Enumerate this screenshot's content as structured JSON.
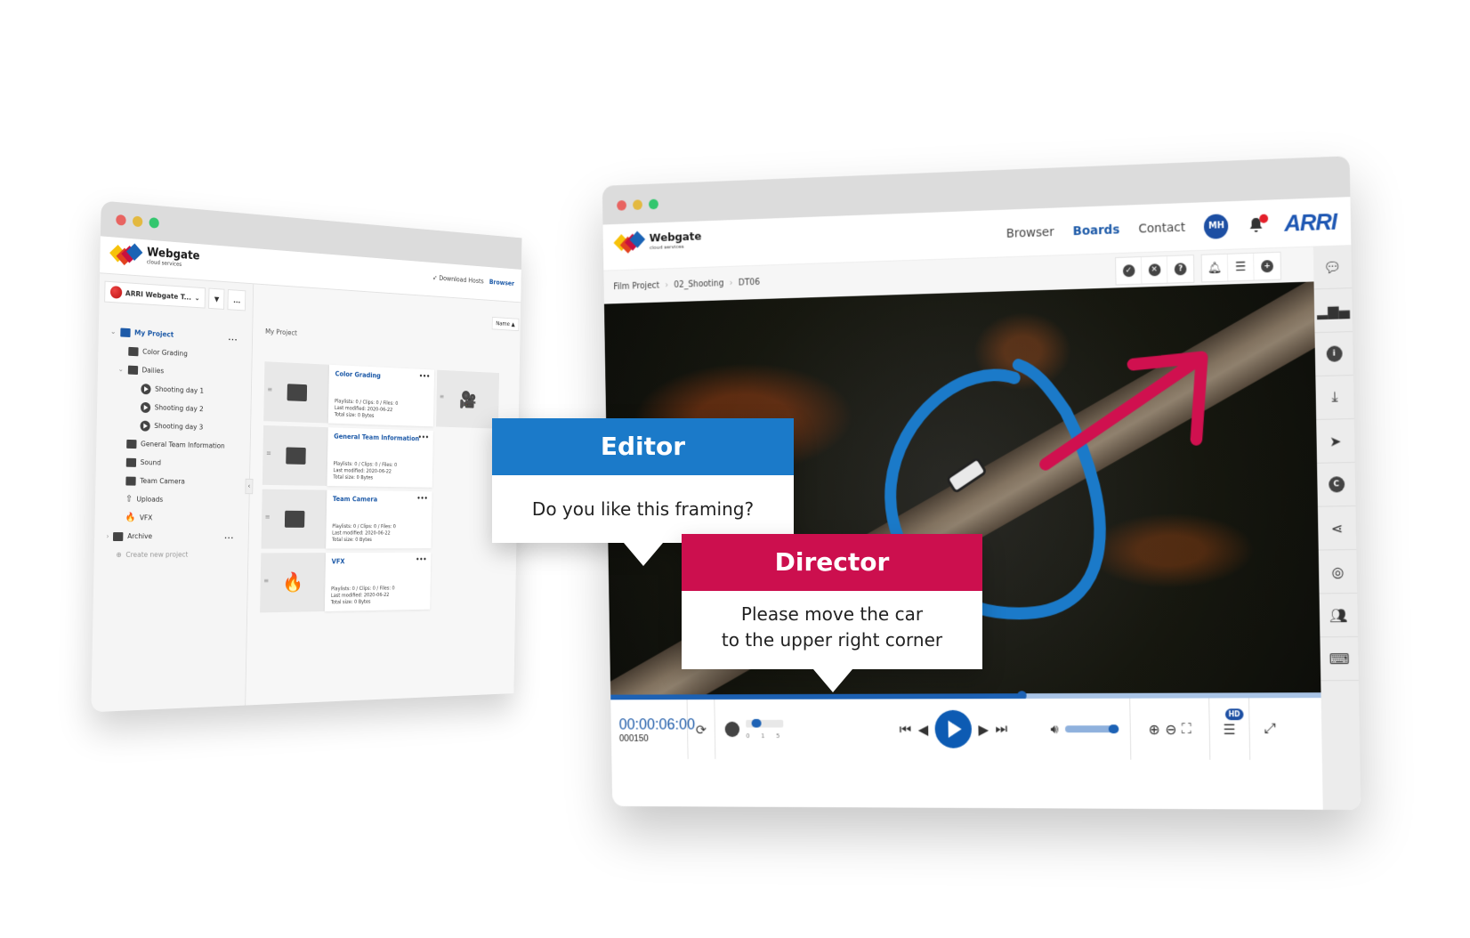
{
  "back_window": {
    "logo": {
      "name": "Webgate",
      "sub": "cloud services"
    },
    "top_links": {
      "download_hosts": "Download Hosts",
      "browser": "Browser"
    },
    "workspace": {
      "name": "ARRI Webgate T...",
      "filter_label": "Filter",
      "more_label": "..."
    },
    "tree": [
      {
        "label": "My Project",
        "level": 0,
        "icon": "briefcase-icon",
        "expanded": true,
        "active": true,
        "more": "..."
      },
      {
        "label": "Color Grading",
        "level": 1,
        "icon": "image-folder-icon"
      },
      {
        "label": "Dailies",
        "level": 1,
        "icon": "movie-camera-icon",
        "expanded": true
      },
      {
        "label": "Shooting day 1",
        "level": 2,
        "icon": "play-circle-icon"
      },
      {
        "label": "Shooting day 2",
        "level": 2,
        "icon": "play-circle-icon"
      },
      {
        "label": "Shooting day 3",
        "level": 2,
        "icon": "play-circle-icon"
      },
      {
        "label": "General Team Information",
        "level": 1,
        "icon": "folder-icon"
      },
      {
        "label": "Sound",
        "level": 1,
        "icon": "music-folder-icon"
      },
      {
        "label": "Team Camera",
        "level": 1,
        "icon": "video-folder-icon"
      },
      {
        "label": "Uploads",
        "level": 1,
        "icon": "upload-icon"
      },
      {
        "label": "VFX",
        "level": 1,
        "icon": "fire-icon"
      },
      {
        "label": "Archive",
        "level": 0,
        "icon": "briefcase-icon",
        "expanded": false,
        "more": "..."
      }
    ],
    "create_project": "Create new project",
    "breadcrumb": "My Project",
    "sort": "Name ▲",
    "cards": [
      {
        "title": "Color Grading",
        "icon": "image-folder-icon",
        "playlists": "Playlists: 0 / Clips: 0 / Files: 0",
        "modified": "Last modified: 2020-06-22",
        "size": "Total size: 0 Bytes"
      },
      {
        "title": "General Team Information",
        "icon": "folder-icon",
        "playlists": "Playlists: 0 / Clips: 0 / Files: 0",
        "modified": "Last modified: 2020-06-22",
        "size": "Total size: 0 Bytes"
      },
      {
        "title": "Team Camera",
        "icon": "video-folder-icon",
        "playlists": "Playlists: 0 / Clips: 0 / Files: 0",
        "modified": "Last modified: 2020-06-22",
        "size": "Total size: 0 Bytes"
      },
      {
        "title": "VFX",
        "icon": "fire-icon",
        "playlists": "Playlists: 0 / Clips: 0 / Files: 0",
        "modified": "Last modified: 2020-06-22",
        "size": "Total size: 0 Bytes"
      }
    ]
  },
  "front_window": {
    "logo": {
      "name": "Webgate",
      "sub": "cloud services"
    },
    "nav": {
      "browser": "Browser",
      "boards": "Boards",
      "contact": "Contact"
    },
    "user_initials": "MH",
    "brand": "ARRI",
    "breadcrumb": [
      "Film Project",
      "02_Shooting",
      "DT06"
    ],
    "toolbar_icons": [
      "approve-icon",
      "reject-icon",
      "question-icon",
      "bell-icon",
      "list-icon",
      "add-icon"
    ],
    "player": {
      "timecode": "00:00:06:00",
      "frame": "000150",
      "progress": 0.59,
      "speed_ticks": [
        "0",
        "1",
        "5"
      ],
      "speed_value": 1,
      "volume": 1.0,
      "quality_badge": "HD"
    },
    "side_rail": [
      "comments-icon",
      "stats-icon",
      "info-icon",
      "download-icon",
      "send-icon",
      "copyright-icon",
      "share-icon",
      "support-icon",
      "users-icon",
      "keyboard-icon"
    ],
    "colors": {
      "accent": "#1d5aa8",
      "editor": "#1b7ac9",
      "director": "#cc0f4e",
      "annotation_blue": "#1b7ac9",
      "annotation_red": "#d0104f"
    }
  },
  "callouts": {
    "editor": {
      "author": "Editor",
      "message": "Do you like this framing?"
    },
    "director": {
      "author": "Director",
      "message_line1": "Please move the car",
      "message_line2": "to the upper right corner"
    }
  }
}
